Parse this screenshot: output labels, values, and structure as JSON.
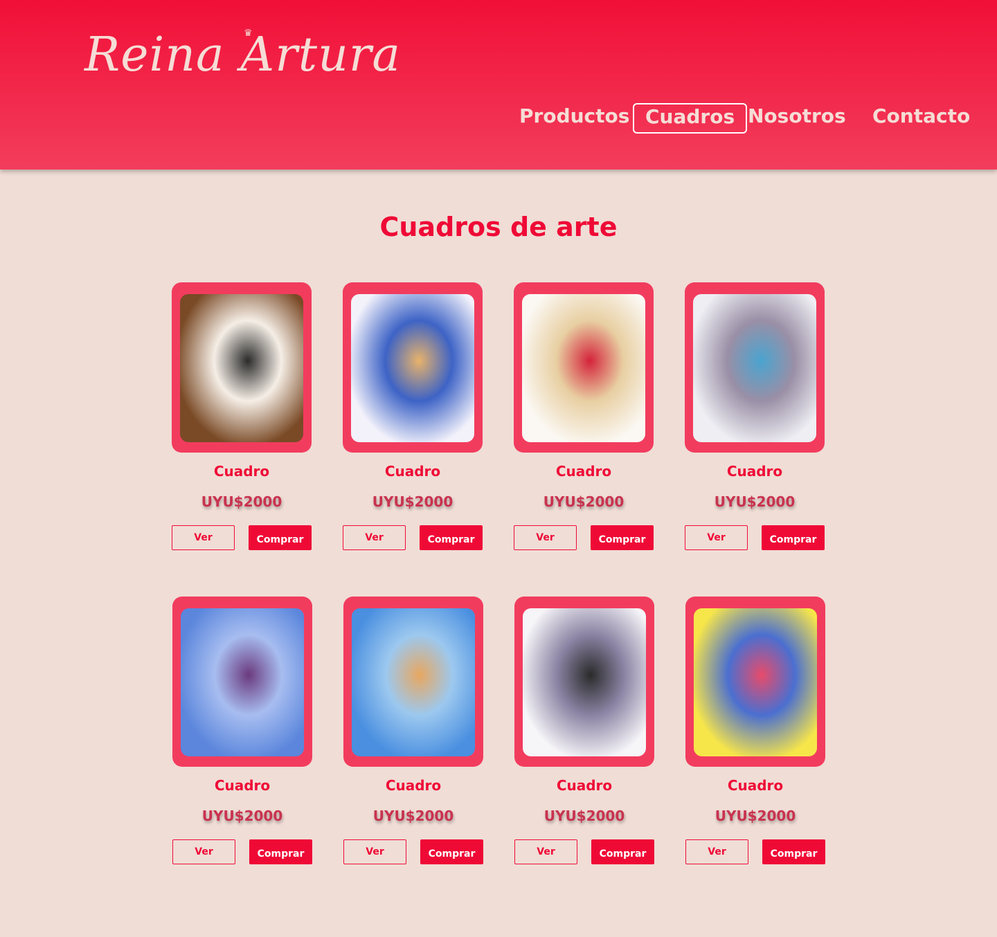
{
  "header": {
    "logo": "Reina Artura",
    "nav": [
      {
        "label": "Productos"
      },
      {
        "label": "Cuadros",
        "active": true
      },
      {
        "label": "Nosotros"
      },
      {
        "label": "Contacto"
      }
    ]
  },
  "colors": {
    "primary": "#ef0a36",
    "frame": "#f23c5e",
    "background": "#f0ddd6"
  },
  "main": {
    "title": "Cuadros de arte",
    "products": [
      {
        "name": "Cuadro",
        "price": "UYU$2000",
        "ver": "Ver",
        "comprar": "Comprar",
        "palette": [
          "#7a4a26",
          "#f5eee6",
          "#2b2b2b"
        ]
      },
      {
        "name": "Cuadro",
        "price": "UYU$2000",
        "ver": "Ver",
        "comprar": "Comprar",
        "palette": [
          "#f3f2fb",
          "#3d63c6",
          "#e9b36a"
        ]
      },
      {
        "name": "Cuadro",
        "price": "UYU$2000",
        "ver": "Ver",
        "comprar": "Comprar",
        "palette": [
          "#fbf8f3",
          "#e8cfa2",
          "#d4233a"
        ]
      },
      {
        "name": "Cuadro",
        "price": "UYU$2000",
        "ver": "Ver",
        "comprar": "Comprar",
        "palette": [
          "#eeeef3",
          "#9a8fa6",
          "#4aa4d0"
        ]
      },
      {
        "name": "Cuadro",
        "price": "UYU$2000",
        "ver": "Ver",
        "comprar": "Comprar",
        "palette": [
          "#5b86dc",
          "#a7bdf0",
          "#6b3a7e"
        ]
      },
      {
        "name": "Cuadro",
        "price": "UYU$2000",
        "ver": "Ver",
        "comprar": "Comprar",
        "palette": [
          "#4a8fe0",
          "#9cc8ef",
          "#e8a760"
        ]
      },
      {
        "name": "Cuadro",
        "price": "UYU$2000",
        "ver": "Ver",
        "comprar": "Comprar",
        "palette": [
          "#f6f5f8",
          "#8a83a3",
          "#2b2b2b"
        ]
      },
      {
        "name": "Cuadro",
        "price": "UYU$2000",
        "ver": "Ver",
        "comprar": "Comprar",
        "palette": [
          "#f7e64a",
          "#4b6fd0",
          "#e84b6a"
        ]
      }
    ]
  }
}
